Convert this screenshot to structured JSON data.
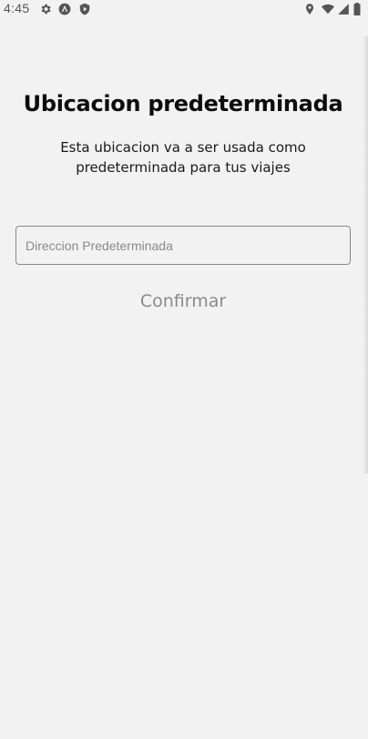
{
  "status_bar": {
    "time": "4:45",
    "left_icons": [
      "settings-icon",
      "app-icon",
      "shield-play-icon"
    ],
    "right_icons": [
      "location-icon",
      "wifi-icon",
      "signal-icon",
      "battery-icon"
    ]
  },
  "main": {
    "title": "Ubicacion predeterminada",
    "subtitle": "Esta ubicacion va a ser usada como predeterminada para tus viajes",
    "address_input": {
      "placeholder": "Direccion Predeterminada",
      "value": ""
    },
    "confirm_label": "Confirmar"
  },
  "colors": {
    "background": "#f2f2f2",
    "title": "#0d0d0d",
    "muted": "#8a8a8a"
  }
}
